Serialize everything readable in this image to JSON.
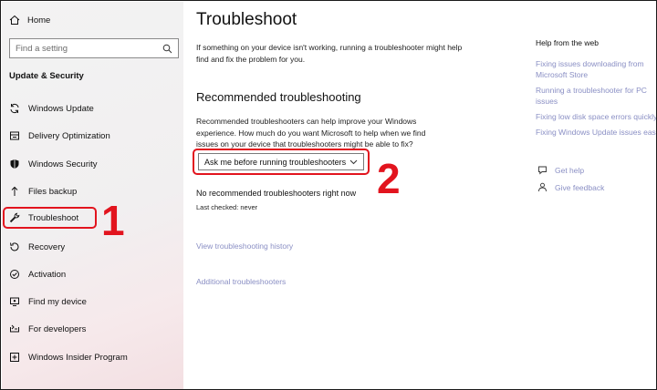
{
  "sidebar": {
    "home_label": "Home",
    "search_placeholder": "Find a setting",
    "section_title": "Update & Security",
    "items": [
      {
        "label": "Windows Update",
        "icon": "sync-icon"
      },
      {
        "label": "Delivery Optimization",
        "icon": "delivery-icon"
      },
      {
        "label": "Windows Security",
        "icon": "shield-icon"
      },
      {
        "label": "Files backup",
        "icon": "backup-icon"
      },
      {
        "label": "Troubleshoot",
        "icon": "wrench-icon",
        "active": true
      },
      {
        "label": "Recovery",
        "icon": "recovery-icon"
      },
      {
        "label": "Activation",
        "icon": "activation-icon"
      },
      {
        "label": "Find my device",
        "icon": "find-device-icon"
      },
      {
        "label": "For developers",
        "icon": "developer-icon"
      },
      {
        "label": "Windows Insider Program",
        "icon": "insider-icon"
      }
    ]
  },
  "main": {
    "title": "Troubleshoot",
    "intro": "If something on your device isn't working, running a troubleshooter might help find and fix the problem for you.",
    "rec_heading": "Recommended troubleshooting",
    "rec_desc": "Recommended troubleshooters can help improve your Windows experience. How much do you want Microsoft to help when we find issues on your device that troubleshooters might be able to fix?",
    "dropdown_value": "Ask me before running troubleshooters",
    "no_rec": "No recommended troubleshooters right now",
    "last_checked": "Last checked: never",
    "history_link": "View troubleshooting history",
    "additional_link": "Additional troubleshooters"
  },
  "help": {
    "title": "Help from the web",
    "links": [
      "Fixing issues downloading from Microsoft Store",
      "Running a troubleshooter for PC issues",
      "Fixing low disk space errors quickly",
      "Fixing Windows Update issues easily"
    ],
    "get_help": "Get help",
    "give_feedback": "Give feedback"
  },
  "annotations": {
    "marker_1": "1",
    "marker_2": "2",
    "highlight_color": "#e2141e"
  },
  "colors": {
    "link": "#8a8fc4",
    "sidebar_bg": "#f2f2f2"
  }
}
